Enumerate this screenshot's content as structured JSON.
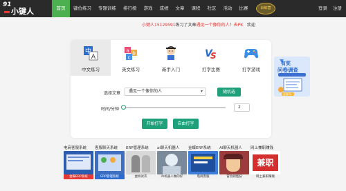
{
  "logo": {
    "number": "91",
    "name": "小键人"
  },
  "nav": {
    "items": [
      {
        "label": "首页",
        "active": true
      },
      {
        "label": "键位练习"
      },
      {
        "label": "专题训练"
      },
      {
        "label": "排行榜"
      },
      {
        "label": "游戏"
      },
      {
        "label": "成绩"
      },
      {
        "label": "文章"
      },
      {
        "label": "课程"
      },
      {
        "label": "社区"
      },
      {
        "label": "活动"
      },
      {
        "label": "比赛"
      }
    ],
    "promo": "训练营",
    "login": "登录",
    "register": "注册"
  },
  "news": {
    "user": "小键人15129591",
    "action": "练习了文章",
    "article": "遇见一个像你的人",
    "separator": "！",
    "go": "去PK",
    "tail": "欢迎"
  },
  "tabs": [
    {
      "label": "中文练习",
      "icon": "chinese-practice-icon",
      "active": true
    },
    {
      "label": "英文练习",
      "icon": "english-practice-icon"
    },
    {
      "label": "新手入门",
      "icon": "beginner-icon"
    },
    {
      "label": "打字比赛",
      "icon": "typing-contest-icon"
    },
    {
      "label": "打字游戏",
      "icon": "typing-game-icon"
    }
  ],
  "form": {
    "article_label": "选择文章",
    "article_value": "遇见一个像你的人",
    "random_button": "随机选",
    "time_label": "时间/分钟",
    "time_value": "2",
    "start_button": "开始打字",
    "free_button": "自由打字"
  },
  "survey": {
    "line1": "有奖",
    "line2": "问卷调查",
    "button": "去参与"
  },
  "ads": [
    {
      "title": "电商客服系统",
      "caption": "金蝶ERP系统",
      "bg": "#2a5db0"
    },
    {
      "title": "客服聊天系统",
      "caption": "ERP管理系统",
      "bg": "#3d6fc0"
    },
    {
      "title": "ERP管理系统",
      "caption": "虚拟试衣",
      "bg": "#c7c7c7"
    },
    {
      "title": "ai聊天机器人",
      "caption": "AI机器人做的好",
      "bg": "#7a8a9a"
    },
    {
      "title": "金蝶ERP系统",
      "caption": "电商客服",
      "bg": "#3b7dd8"
    },
    {
      "title": "AI聊天机器人",
      "caption": "冒险刷怪技",
      "bg": "#9c3b3b"
    },
    {
      "title": "网上兼职赚钱",
      "caption": "网上兼职赚钱",
      "bg": "#f1f1f1"
    }
  ]
}
